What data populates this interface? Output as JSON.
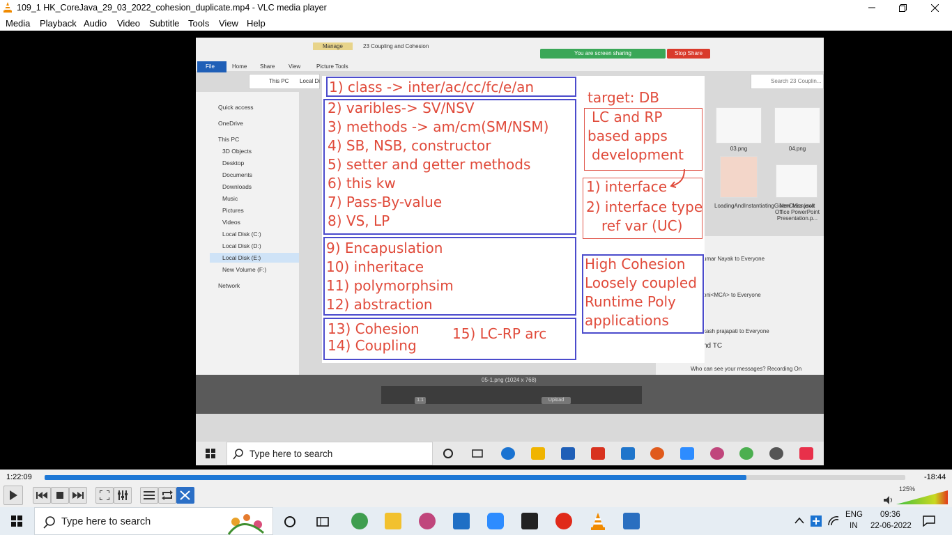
{
  "window": {
    "title": "109_1 HK_CoreJava_29_03_2022_cohesion_duplicate.mp4 - VLC media player",
    "minimize_icon": "minimize-icon",
    "maximize_icon": "restore-icon",
    "close_icon": "close-icon"
  },
  "menu": [
    "Media",
    "Playback",
    "Audio",
    "Video",
    "Subtitle",
    "Tools",
    "View",
    "Help"
  ],
  "shared_screen": {
    "ribbon_tab_manage": "Manage",
    "folder_title": "23 Coupling and Cohesion",
    "ribbon_tabs": [
      "File",
      "Home",
      "Share",
      "View",
      "Picture Tools"
    ],
    "sharing_banner": "You are screen sharing",
    "stop_share": "Stop Share",
    "address": [
      "This PC",
      "Local Di"
    ],
    "search_placeholder": "Search 23 Couplin...",
    "sidebar": [
      "Quick access",
      "OneDrive",
      "This PC",
      "3D Objects",
      "Desktop",
      "Documents",
      "Downloads",
      "Music",
      "Pictures",
      "Videos",
      "Local Disk (C:)",
      "Local Disk (D:)",
      "Local Disk (E:)",
      "New Volume (F:)",
      "Network"
    ],
    "files": [
      "03.png",
      "04.png",
      "LoadingAndInstantiatingGivenClass.java",
      "New Microsoft Office PowerPoint Presentation.p..."
    ],
    "chat_lines": [
      "umar Nayak to Everyone",
      "oni<MCA> to Everyone",
      "kash prajapati to Everyone",
      "nd TC",
      "Who can see your messages? Recording On"
    ],
    "photo_caption": "05-1.png (1024 x 768)",
    "photo_buttons": [
      "1:1",
      "Upload"
    ],
    "taskbar_search": "Type here to search"
  },
  "slide": {
    "box1": [
      "1) class -> inter/ac/cc/fc/e/an"
    ],
    "box2": [
      "2) varibles-> SV/NSV",
      "3) methods -> am/cm(SM/NSM)",
      "4) SB, NSB, constructor",
      "5) setter and getter methods",
      "6) this kw",
      "7) Pass-By-value",
      "8) VS, LP"
    ],
    "box3": [
      "9) Encapuslation",
      "10) inheritace",
      "11) polymorphsim",
      "12) abstraction"
    ],
    "box4": [
      "13) Cohesion",
      "14) Coupling"
    ],
    "box4_right": "15) LC-RP arc",
    "target": "target:  DB",
    "target_box": [
      "LC and RP",
      "based apps",
      "development"
    ],
    "iface_box": [
      "1) interface",
      "2) interface type",
      "ref var (UC)"
    ],
    "cohesion_box": [
      "High Cohesion",
      "Loosely coupled",
      "Runtime Poly",
      "applications"
    ]
  },
  "player": {
    "elapsed": "1:22:09",
    "remaining": "-18:44",
    "progress": 0.815,
    "volume": "125%",
    "volume_level": 1.0,
    "accent": "#1e78d6"
  },
  "taskbar": {
    "search": "Type here to search",
    "lang1": "ENG",
    "lang2": "IN",
    "time": "09:36",
    "date": "22-06-2022"
  }
}
